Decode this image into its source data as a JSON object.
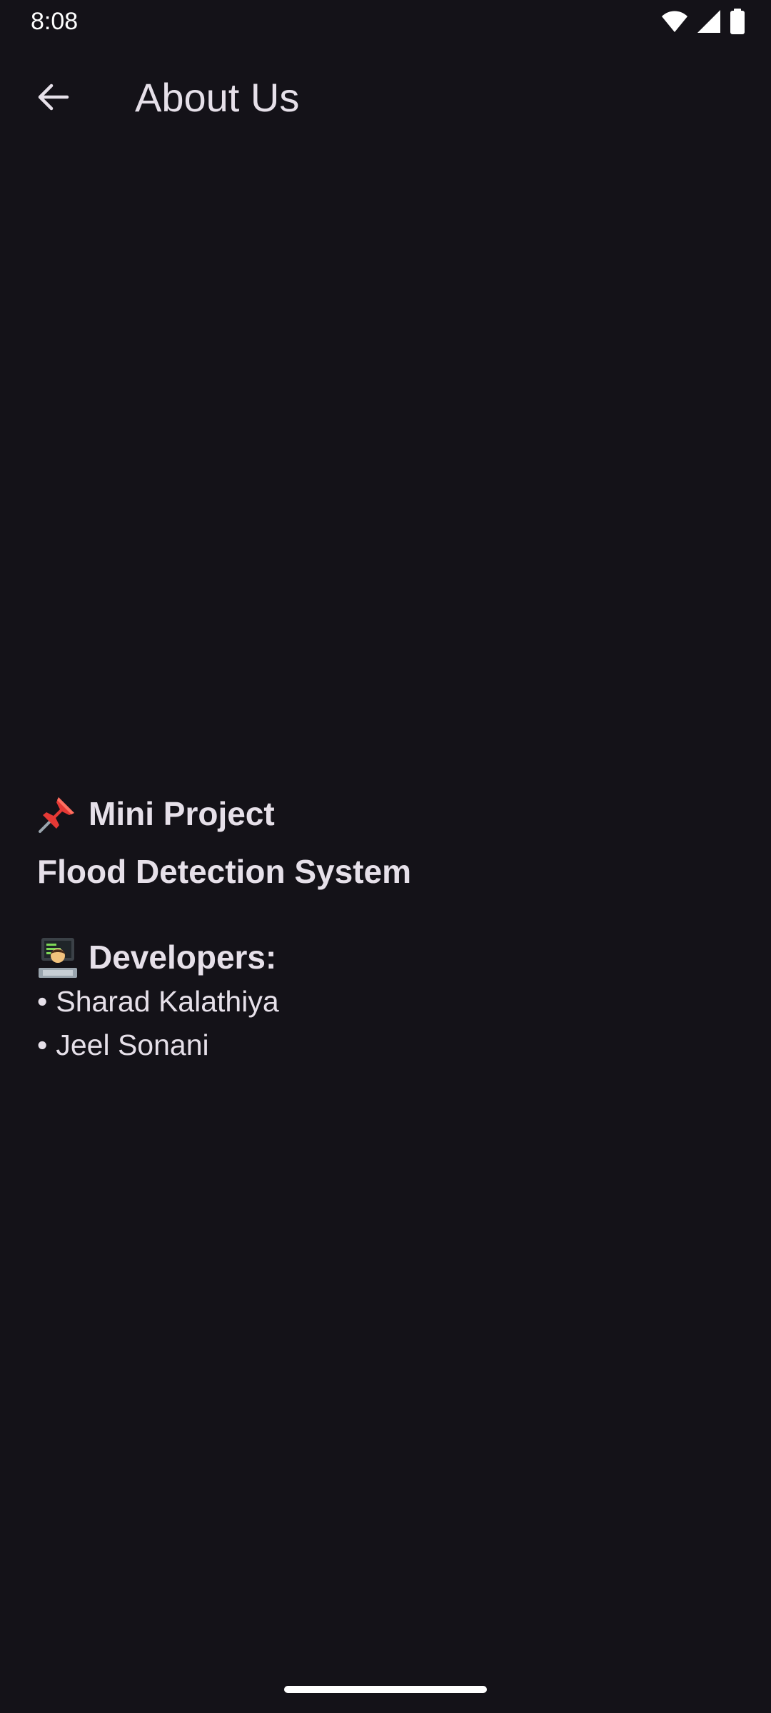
{
  "status_bar": {
    "time": "8:08",
    "icons": [
      "wifi-icon",
      "signal-icon",
      "battery-icon"
    ]
  },
  "app_bar": {
    "back_icon": "arrow-back-icon",
    "title": "About Us"
  },
  "project": {
    "icon": "pushpin-icon",
    "heading": "Mini Project",
    "name": "Flood Detection System"
  },
  "developers": {
    "icon": "technologist-icon",
    "heading": "Developers:",
    "bullet": "•",
    "items": [
      {
        "name": "Sharad Kalathiya"
      },
      {
        "name": "Jeel Sonani"
      }
    ]
  },
  "colors": {
    "background": "#141218",
    "text": "#e6e0e9",
    "status_text": "#ffffff"
  }
}
